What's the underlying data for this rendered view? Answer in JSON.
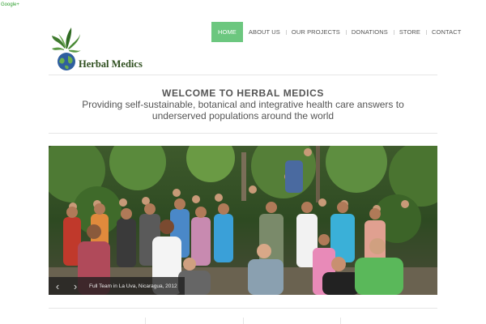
{
  "top_tag": "Google+",
  "site": {
    "name": "Herbal Medics"
  },
  "nav": {
    "items": [
      {
        "label": "HOME",
        "active": true
      },
      {
        "label": "ABOUT US",
        "active": false
      },
      {
        "label": "OUR PROJECTS",
        "active": false
      },
      {
        "label": "DONATIONS",
        "active": false
      },
      {
        "label": "STORE",
        "active": false
      },
      {
        "label": "CONTACT",
        "active": false
      }
    ]
  },
  "hero": {
    "heading": "WELCOME TO HERBAL MEDICS",
    "tagline": "Providing self-sustainable, botanical and integrative health care answers to underserved populations around the world"
  },
  "slider": {
    "caption": "Full Team in La Uva, Nicaragua, 2012",
    "prev_icon": "chevron-left-icon",
    "next_icon": "chevron-right-icon"
  },
  "colors": {
    "accent": "#6cc77f",
    "text": "#555555",
    "logo_text": "#2f4f1f"
  }
}
